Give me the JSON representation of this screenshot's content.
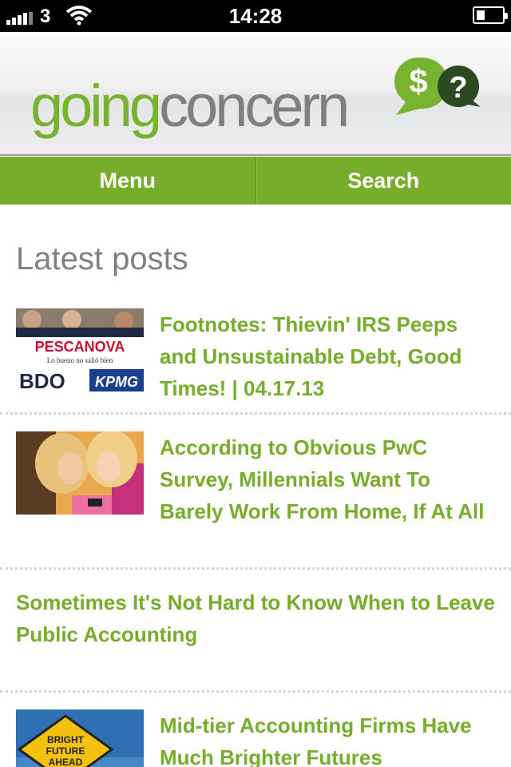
{
  "status_bar": {
    "carrier": "3",
    "time": "14:28"
  },
  "header": {
    "logo_part1": "going",
    "logo_part2": "concern",
    "logo_symbols": [
      "$",
      "?"
    ]
  },
  "nav": {
    "menu_label": "Menu",
    "search_label": "Search"
  },
  "section_title": "Latest posts",
  "posts": [
    {
      "title": "Footnotes: Thievin' IRS Peeps and Unsustainable Debt, Good Times! | 04.17.13",
      "thumb_text": [
        "PESCANOVA",
        "Lo bueno no salió bien",
        "BDO",
        "KPMG"
      ]
    },
    {
      "title": "According to Obvious PwC Survey, Millennials Want To Barely Work From Home, If At All"
    },
    {
      "title": "Sometimes It's Not Hard to Know When to Leave Public Accounting"
    },
    {
      "title": "Mid-tier Accounting Firms Have Much Brighter Futures",
      "thumb_text": [
        "BRIGHT",
        "FUTURE",
        "AHEAD"
      ]
    }
  ],
  "colors": {
    "accent_green": "#76ad2b",
    "logo_grey": "#7f7f7f"
  }
}
